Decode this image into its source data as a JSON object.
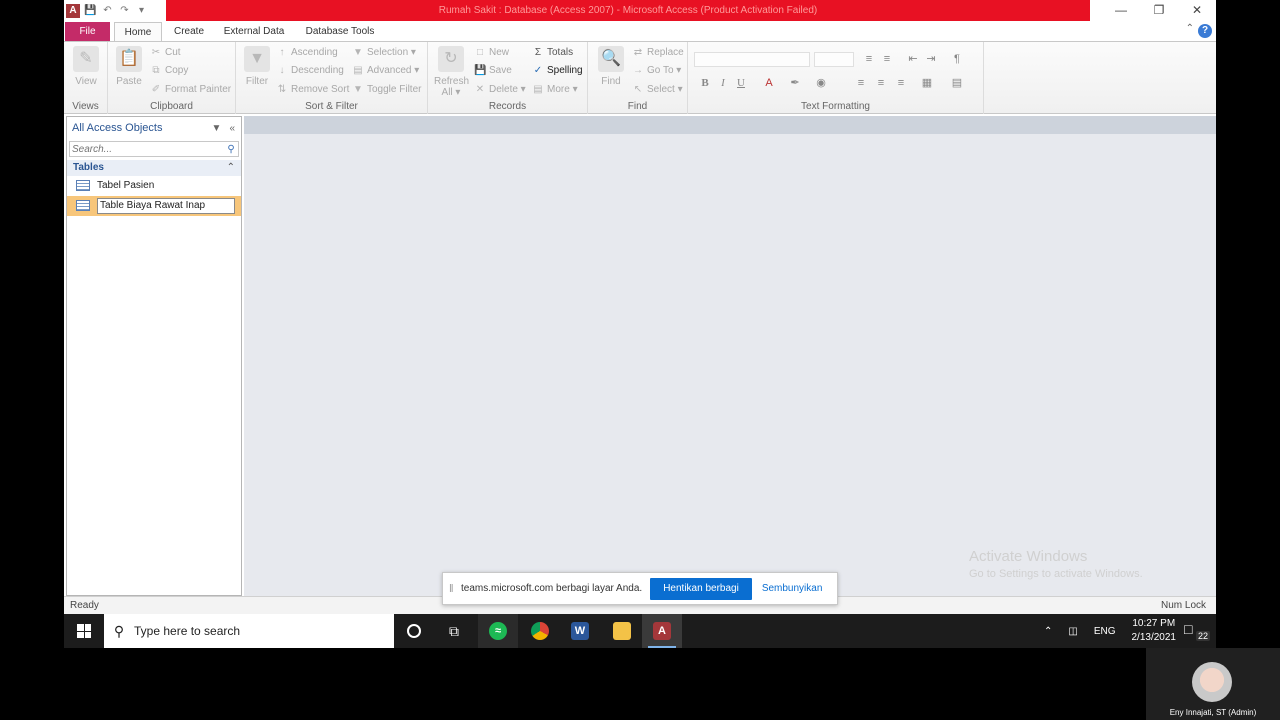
{
  "window": {
    "title": "Rumah Sakit : Database (Access 2007) - Microsoft Access (Product Activation Failed)"
  },
  "tabs": [
    "File",
    "Home",
    "Create",
    "External Data",
    "Database Tools"
  ],
  "ribbon": {
    "views": {
      "view_label": "View",
      "group_label": "Views"
    },
    "clipboard": {
      "paste": "Paste",
      "cut": "Cut",
      "copy": "Copy",
      "format_painter": "Format Painter",
      "group_label": "Clipboard"
    },
    "sort_filter": {
      "filter": "Filter",
      "ascending": "Ascending",
      "descending": "Descending",
      "remove_sort": "Remove Sort",
      "selection": "Selection",
      "advanced": "Advanced",
      "toggle_filter": "Toggle Filter",
      "group_label": "Sort & Filter"
    },
    "records": {
      "refresh": "Refresh",
      "refresh_sub": "All",
      "new": "New",
      "save": "Save",
      "delete": "Delete",
      "totals": "Totals",
      "spelling": "Spelling",
      "more": "More",
      "group_label": "Records"
    },
    "find": {
      "find": "Find",
      "replace": "Replace",
      "goto": "Go To",
      "select": "Select",
      "group_label": "Find"
    },
    "text_formatting": {
      "bold": "B",
      "italic": "I",
      "underline": "U",
      "group_label": "Text Formatting"
    }
  },
  "nav": {
    "header": "All Access Objects",
    "search_placeholder": "Search...",
    "section": "Tables",
    "items": [
      {
        "label": "Tabel Pasien"
      },
      {
        "label": "Table Biaya Rawat Inap"
      }
    ]
  },
  "status": {
    "left": "Ready",
    "right": "Num Lock"
  },
  "watermark": {
    "line1": "Activate Windows",
    "line2": "Go to Settings to activate Windows."
  },
  "sharebar": {
    "message": "teams.microsoft.com berbagi layar Anda.",
    "stop_label": "Hentikan berbagi",
    "hide_label": "Sembunyikan"
  },
  "taskbar": {
    "search_placeholder": "Type here to search",
    "lang": "ENG",
    "time": "10:27 PM",
    "date": "2/13/2021",
    "notifications": "22"
  },
  "webcam": {
    "name": "Eny Innajati, ST (Admin)"
  },
  "colors": {
    "title_red": "#e81123",
    "file_tab": "#c42b68",
    "selection": "#f7c67b",
    "teams_blue": "#0a6ed1"
  }
}
